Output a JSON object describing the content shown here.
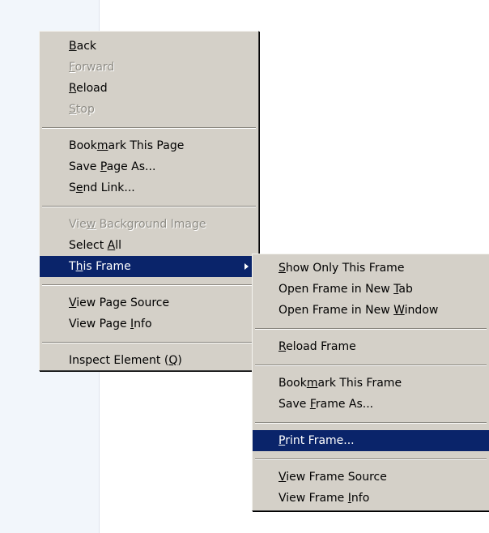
{
  "main_menu": {
    "back": [
      "",
      "B",
      "ack"
    ],
    "forward": [
      "",
      "F",
      "orward"
    ],
    "reload": [
      "",
      "R",
      "eload"
    ],
    "stop": [
      "",
      "S",
      "top"
    ],
    "bookmark_page": [
      "Book",
      "m",
      "ark This Page"
    ],
    "save_page": [
      "Save ",
      "P",
      "age As..."
    ],
    "send_link": [
      "S",
      "e",
      "nd Link..."
    ],
    "view_bg_image": [
      "Vie",
      "w",
      " Background Image"
    ],
    "select_all": [
      "Select ",
      "A",
      "ll"
    ],
    "this_frame": [
      "T",
      "h",
      "is Frame"
    ],
    "view_page_source": [
      "",
      "V",
      "iew Page Source"
    ],
    "view_page_info": [
      "View Page ",
      "I",
      "nfo"
    ],
    "inspect_element": [
      "Inspect Element (",
      "Q",
      ")"
    ]
  },
  "frame_submenu": {
    "show_only_frame": [
      "",
      "S",
      "how Only This Frame"
    ],
    "open_frame_tab": [
      "Open Frame in New ",
      "T",
      "ab"
    ],
    "open_frame_window": [
      "Open Frame in New ",
      "W",
      "indow"
    ],
    "reload_frame": [
      "",
      "R",
      "eload Frame"
    ],
    "bookmark_frame": [
      "Book",
      "m",
      "ark This Frame"
    ],
    "save_frame": [
      "Save ",
      "F",
      "rame As..."
    ],
    "print_frame": [
      "",
      "P",
      "rint Frame..."
    ],
    "view_frame_source": [
      "",
      "V",
      "iew Frame Source"
    ],
    "view_frame_info": [
      "View Frame ",
      "I",
      "nfo"
    ]
  },
  "colors": {
    "menu_bg": "#d4d0c8",
    "highlight": "#0a246a",
    "disabled_text": "#8f8d86"
  }
}
